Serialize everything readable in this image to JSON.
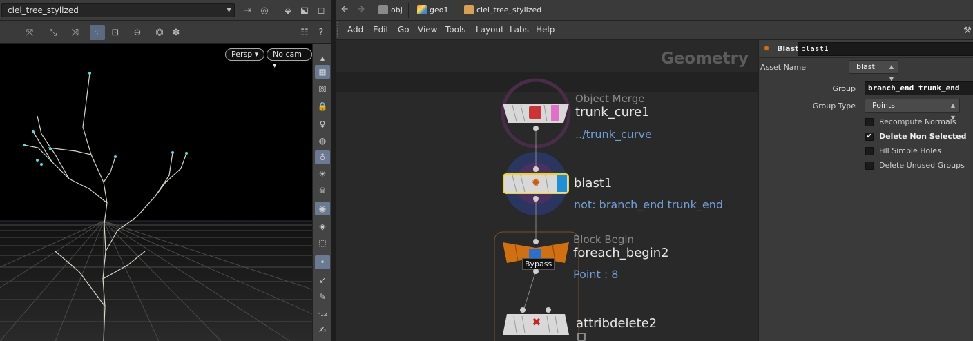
{
  "viewer": {
    "object_dropdown": "ciel_tree_stylized",
    "camera_persp": "Persp",
    "camera_cam": "No cam"
  },
  "path_bar": {
    "crumbs": [
      "obj",
      "geo1",
      "ciel_tree_stylized"
    ]
  },
  "menu": {
    "items": [
      "Add",
      "Edit",
      "Go",
      "View",
      "Tools",
      "Layout",
      "Labs",
      "Help"
    ]
  },
  "network": {
    "context_label": "Geometry",
    "nodes": [
      {
        "type": "Object Merge",
        "name": "trunk_cure1",
        "info": "../trunk_curve"
      },
      {
        "type": "",
        "name": "blast1",
        "info": "not: branch_end trunk_end"
      },
      {
        "type": "Block Begin",
        "name": "foreach_begin2",
        "info": "Point : 8",
        "flag": "Bypass"
      },
      {
        "type": "",
        "name": "attribdelete2",
        "info": ""
      }
    ]
  },
  "params": {
    "node_type": "Blast",
    "node_name": "blast1",
    "asset_name_label": "Asset Name",
    "asset_name_value": "blast",
    "group_label": "Group",
    "group_value": "branch_end trunk_end",
    "group_type_label": "Group Type",
    "group_type_value": "Points",
    "checkboxes": [
      {
        "label": "Recompute Normals",
        "checked": false
      },
      {
        "label": "Delete Non Selected",
        "checked": true
      },
      {
        "label": "Fill Simple Holes",
        "checked": false
      },
      {
        "label": "Delete Unused Groups",
        "checked": false
      }
    ]
  },
  "colors": {
    "accent_select": "#f2d21b",
    "info_text": "#6f9fd8",
    "block_orange": "#d07010",
    "blast_blue": "#1e90d8",
    "merge_pink": "#e070c8"
  }
}
